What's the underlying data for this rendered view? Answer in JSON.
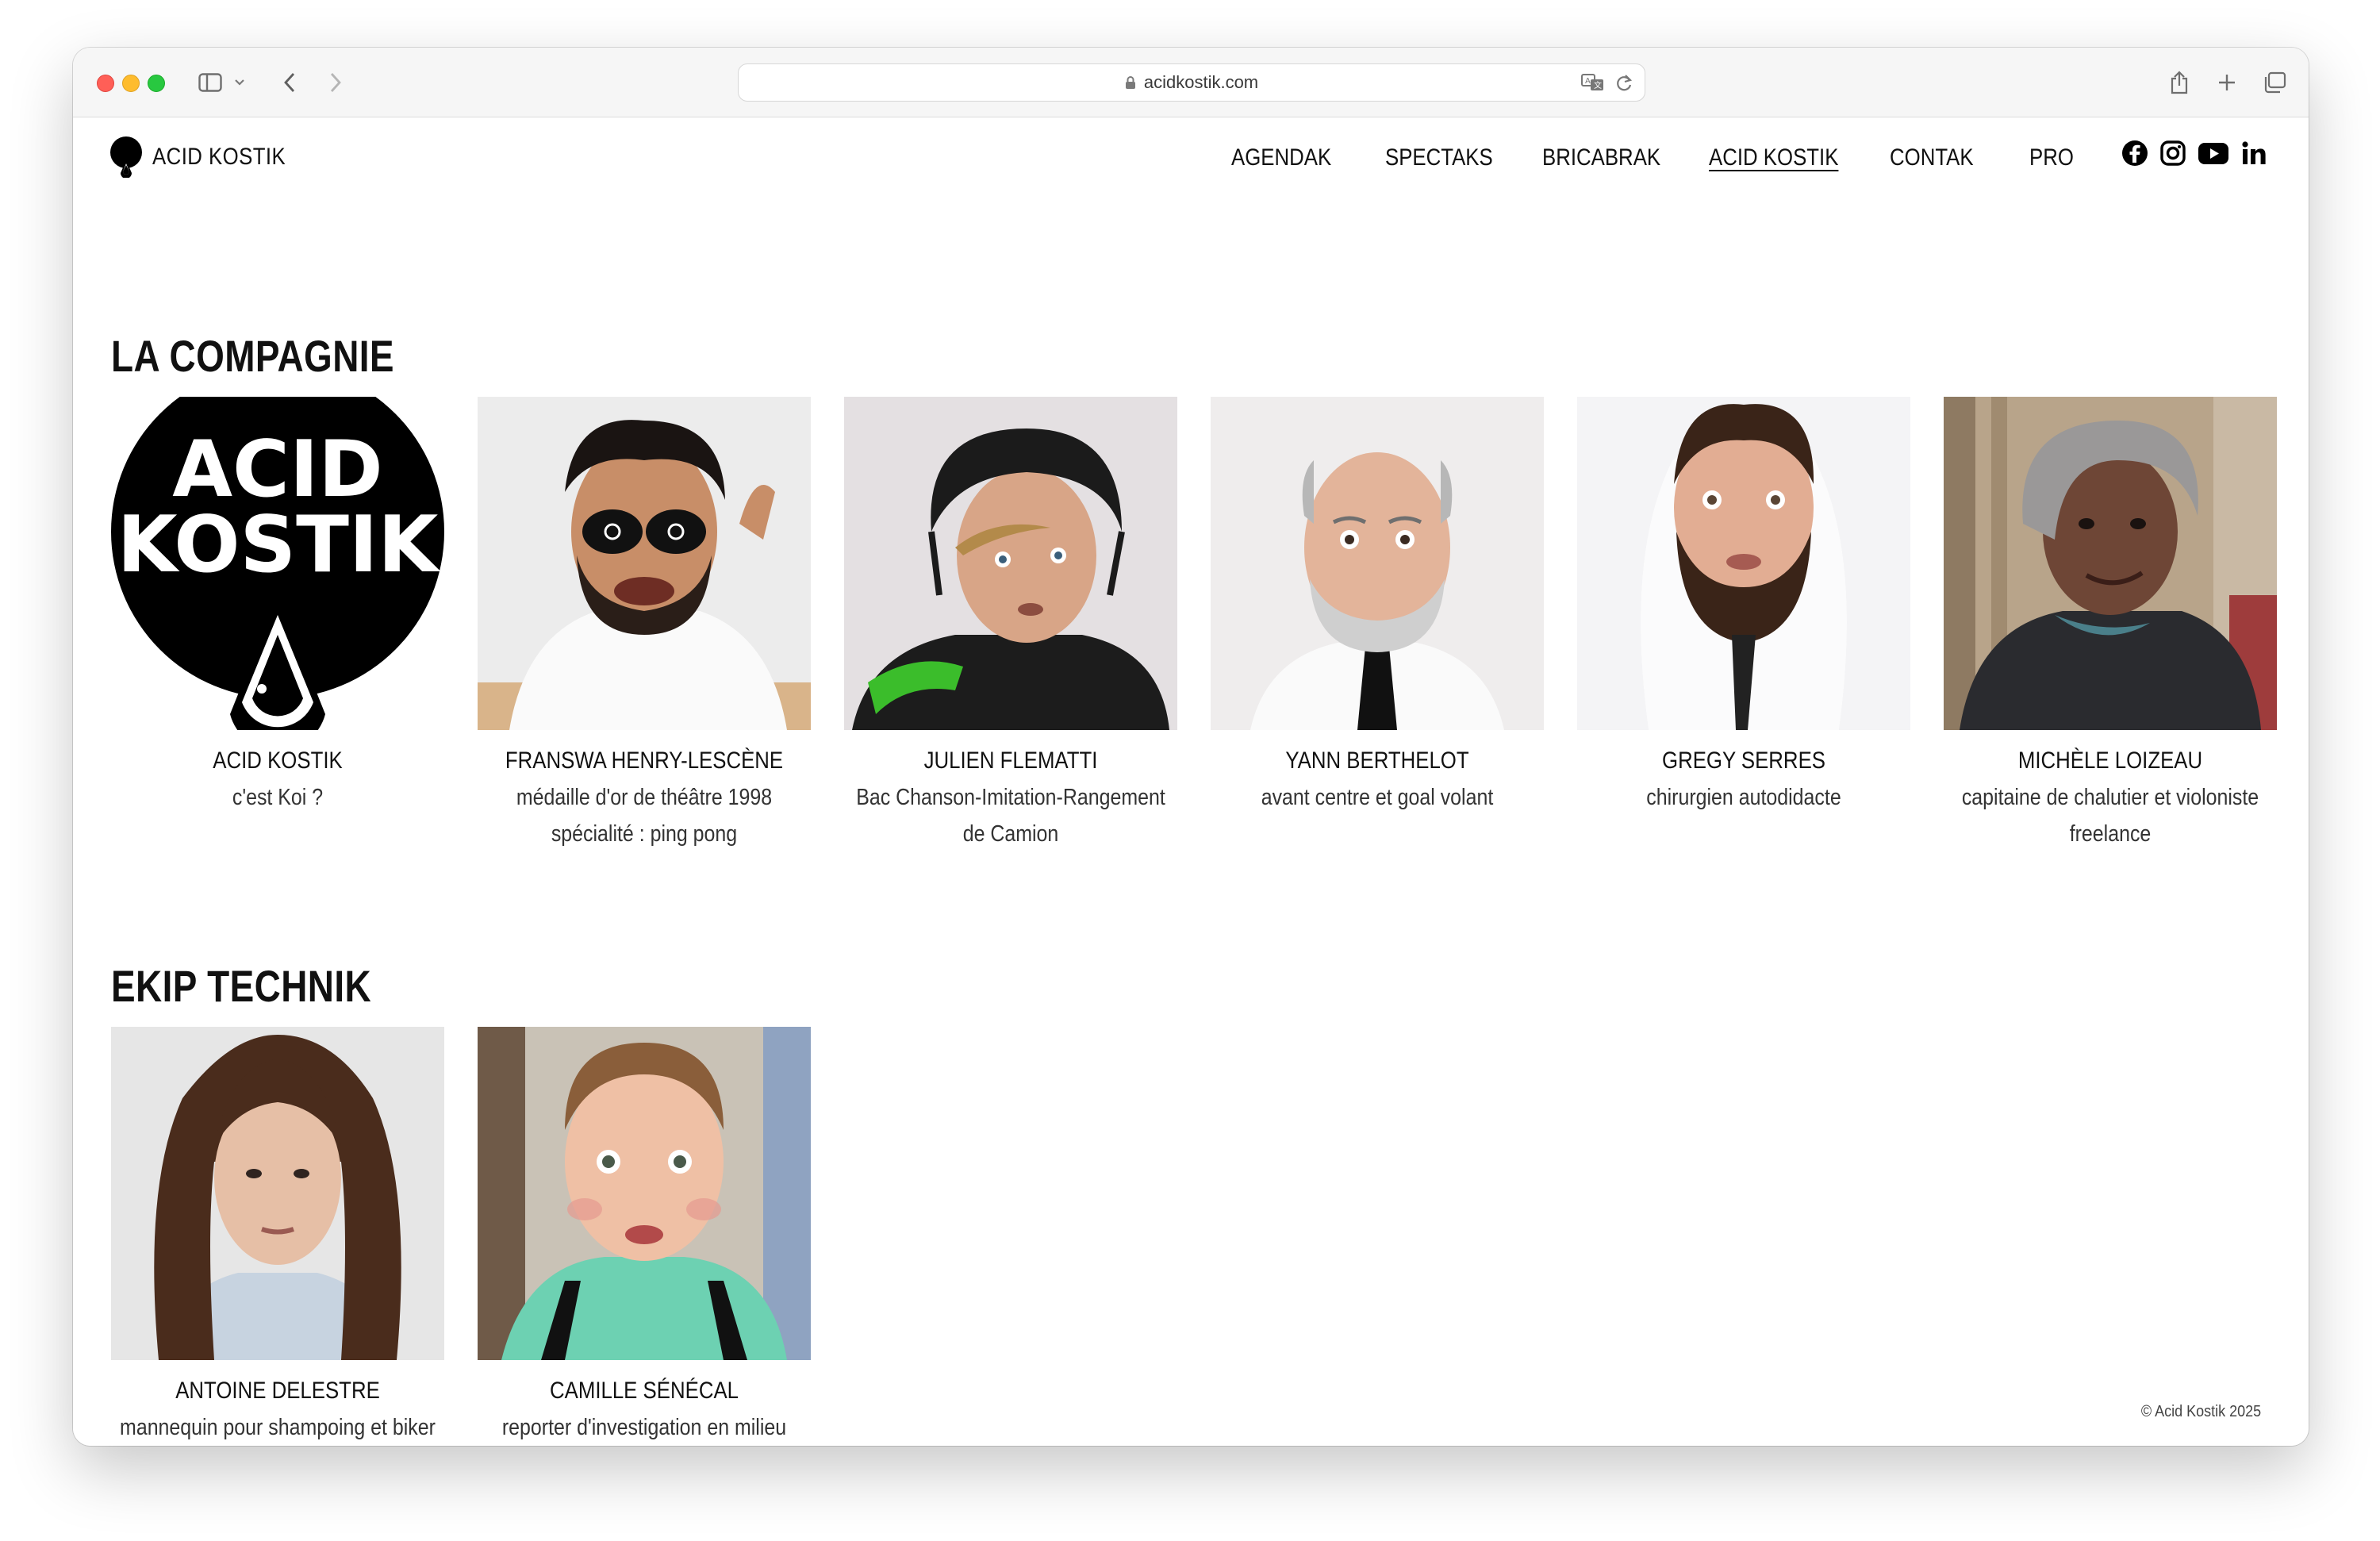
{
  "browser": {
    "url": "acidkostik.com",
    "icons": [
      "sidebar-icon",
      "chevron-down-icon",
      "back-icon",
      "forward-icon",
      "translate-icon",
      "reload-icon",
      "share-icon",
      "new-tab-icon",
      "tabs-overview-icon"
    ]
  },
  "site": {
    "logo_text": "ACID KOSTIK",
    "nav": [
      {
        "label": "AGENDAK",
        "active": false
      },
      {
        "label": "SPECTAKS",
        "active": false
      },
      {
        "label": "BRICABRAK",
        "active": false
      },
      {
        "label": "ACID KOSTIK",
        "active": true
      },
      {
        "label": "CONTAK",
        "active": false
      },
      {
        "label": "PRO",
        "active": false
      }
    ],
    "social": [
      "facebook-icon",
      "instagram-icon",
      "youtube-icon",
      "linkedin-icon"
    ]
  },
  "sections": [
    {
      "title": "LA COMPAGNIE",
      "members": [
        {
          "name": "ACID KOSTIK",
          "role": "c'est Koi ?"
        },
        {
          "name": "FRANSWA HENRY-LESCÈNE",
          "role": "médaille d'or de théâtre 1998 spécialité : ping pong"
        },
        {
          "name": "JULIEN FLEMATTI",
          "role": "Bac Chanson-Imitation-Rangement de Camion"
        },
        {
          "name": "YANN BERTHELOT",
          "role": "avant centre et goal volant"
        },
        {
          "name": "GREGY SERRES",
          "role": "chirurgien autodidacte"
        },
        {
          "name": "MICHÈLE LOIZEAU",
          "role": "capitaine de chalutier et violoniste freelance"
        }
      ]
    },
    {
      "title": "EKIP TECHNIK",
      "members": [
        {
          "name": "ANTOINE DELESTRE",
          "role": "mannequin pour shampoing et biker à mi-temps"
        },
        {
          "name": "CAMILLE SÉNÉCAL",
          "role": "reporter d'investigation en milieu aquatique"
        }
      ]
    }
  ],
  "footer": "© Acid Kostik 2025",
  "colors": {
    "traffic_red": "#ff5f57",
    "traffic_yellow": "#febc2e",
    "traffic_green": "#28c840",
    "text": "#111111"
  }
}
